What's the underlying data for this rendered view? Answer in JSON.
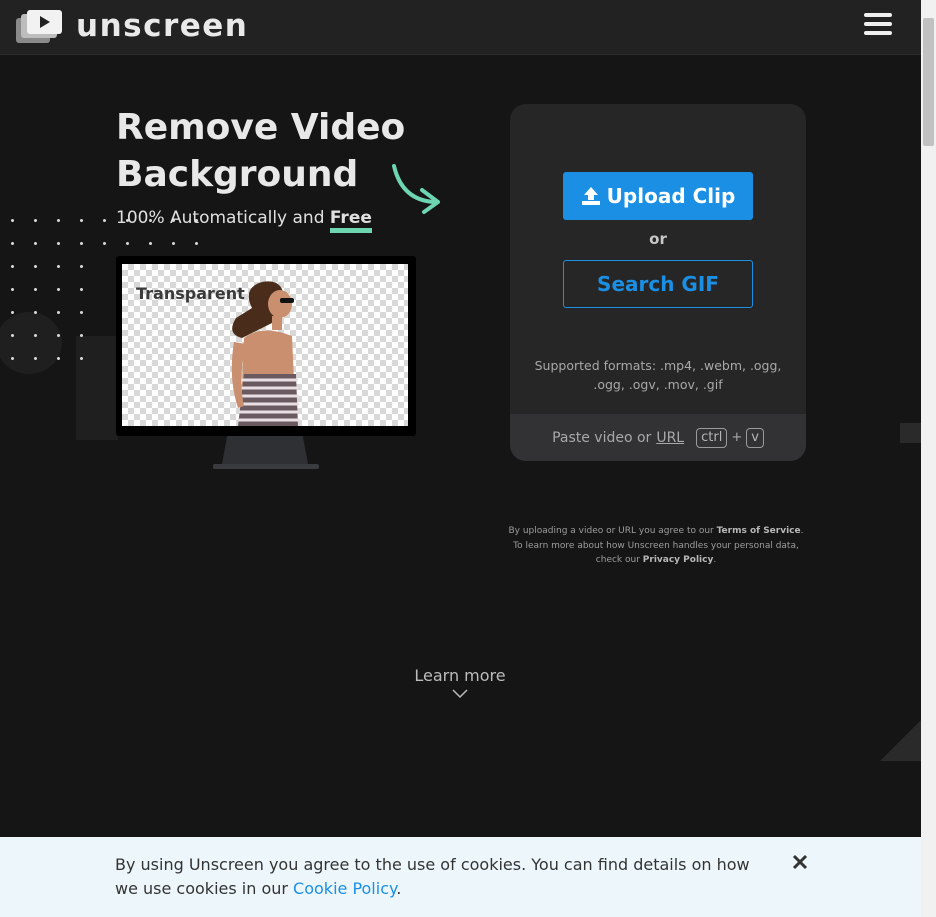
{
  "header": {
    "logo_text": "unscreen",
    "menu_icon": "hamburger-icon"
  },
  "hero": {
    "title": "Remove Video Background",
    "subtitle_prefix": "100% Automatically and ",
    "subtitle_highlight": "Free",
    "screen_label": "Transparent"
  },
  "upload": {
    "upload_label": "Upload Clip",
    "or_label": "or",
    "search_label": "Search GIF",
    "formats": "Supported formats: .mp4, .webm, .ogg, .ogg, .ogv, .mov, .gif",
    "paste_prefix": "Paste video or",
    "paste_link": "URL",
    "key_ctrl": "ctrl",
    "key_plus": "+",
    "key_v": "v"
  },
  "legal": {
    "text1": "By uploading a video or URL you agree to our ",
    "terms": "Terms of Service",
    "text2": ". To learn more about how Unscreen handles your personal data, check our ",
    "privacy": "Privacy Policy",
    "text3": "."
  },
  "learn_more": {
    "label": "Learn more"
  },
  "cookie": {
    "text": "By using Unscreen you agree to the use of cookies. You can find details on how we use cookies in our ",
    "link": "Cookie Policy",
    "suffix": "."
  },
  "colors": {
    "accent": "#1a8fe4",
    "highlight": "#6ed5b1",
    "background": "#151516"
  }
}
